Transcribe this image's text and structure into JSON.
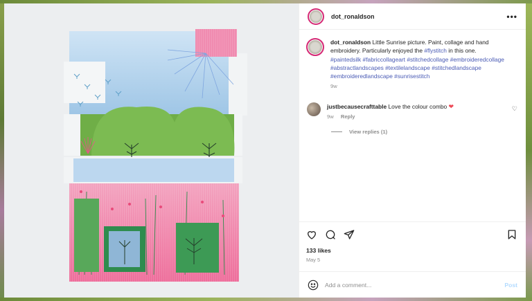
{
  "post": {
    "username": "dot_ronaldson",
    "more_glyph": "•••"
  },
  "caption": {
    "username": "dot_ronaldson",
    "text": "Little Sunrise picture. Paint, collage and hand embroidery. Particularly enjoyed the",
    "inline_tag": "#flystitch",
    "text_after": "in this one.",
    "hashtags": "#paintedsilk #fabriccollageart #stitchedcollage #embroideredcollage #abstractlandscapes #textilelandscape #stitchedlandscape #embroideredlandscape #sunrisestitch",
    "age": "9w"
  },
  "comment": {
    "username": "justbecausecrafttable",
    "text": "Love the colour combo",
    "age": "9w",
    "reply_label": "Reply"
  },
  "view_replies": "View replies (1)",
  "likes": "133 likes",
  "date": "May 5",
  "add_comment": {
    "placeholder": "Add a comment...",
    "post_label": "Post"
  },
  "colors": {
    "accent_link": "#4a5bb5",
    "post_disabled": "#b3dbff",
    "heart": "#ed4956"
  },
  "icons": [
    "heart-icon",
    "comment-icon",
    "share-icon",
    "bookmark-icon",
    "emoji-icon",
    "more-icon"
  ]
}
